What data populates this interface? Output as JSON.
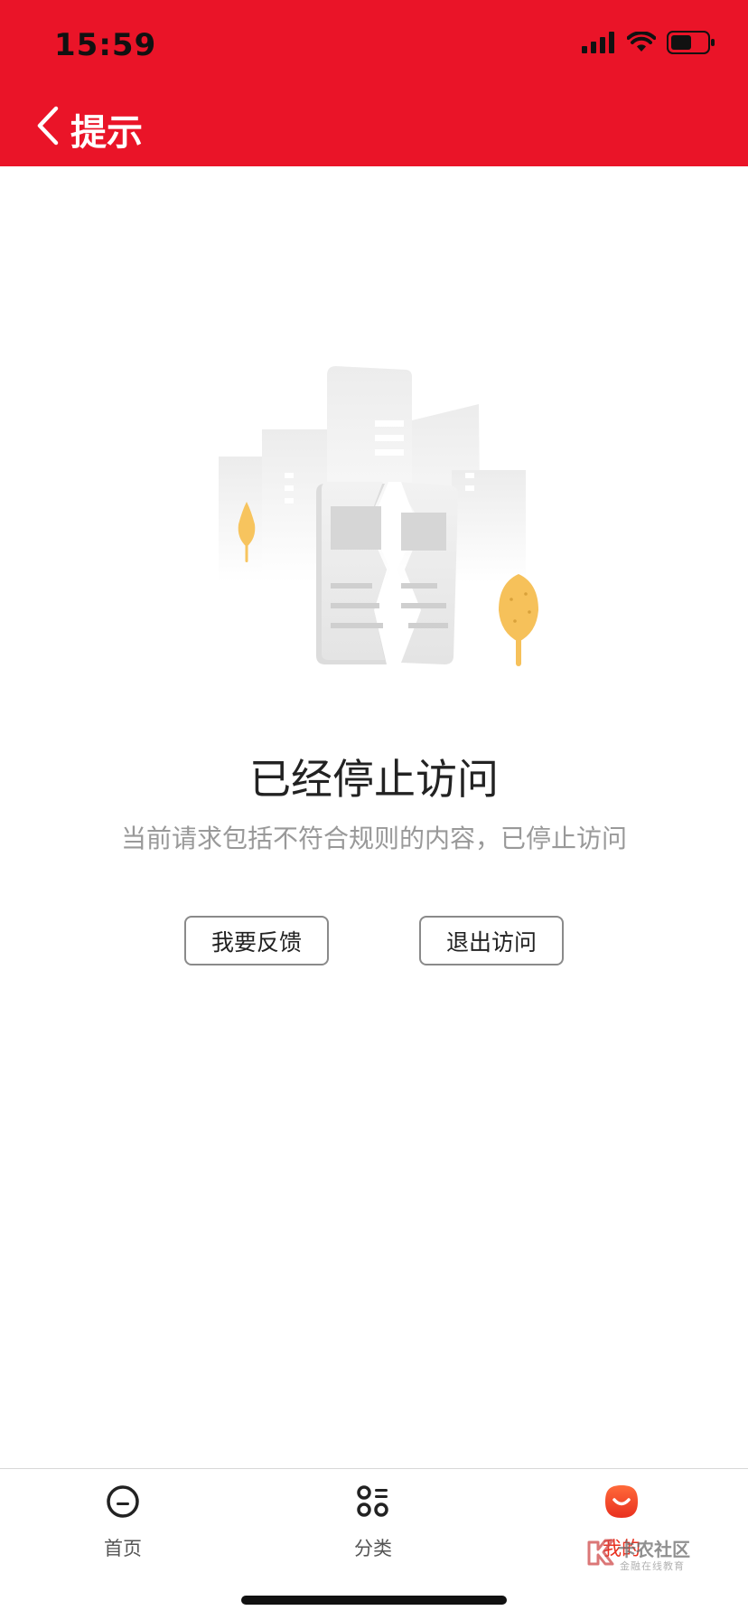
{
  "status_bar": {
    "time": "15:59",
    "icons": [
      "cellular-signal-icon",
      "wifi-icon",
      "battery-icon"
    ]
  },
  "nav": {
    "back_icon": "chevron-left-icon",
    "title": "提示"
  },
  "colors": {
    "header_bg": "#ea1428",
    "accent": "#e9301f",
    "title_text": "#222222",
    "subtitle_text": "#999999",
    "tree": "#f7c45e"
  },
  "content": {
    "illustration": "broken-document-illustration",
    "title": "已经停止访问",
    "subtitle": "当前请求包括不符合规则的内容，已停止访问",
    "buttons": {
      "feedback": "我要反馈",
      "exit": "退出访问"
    }
  },
  "tabbar": {
    "items": [
      {
        "label": "首页",
        "icon": "home-face-icon",
        "active": false
      },
      {
        "label": "分类",
        "icon": "category-grid-icon",
        "active": false
      },
      {
        "label": "我的",
        "icon": "profile-smile-icon",
        "active": true
      }
    ]
  },
  "watermark": {
    "text": "卡农社区",
    "sub": "金融在线教育"
  }
}
